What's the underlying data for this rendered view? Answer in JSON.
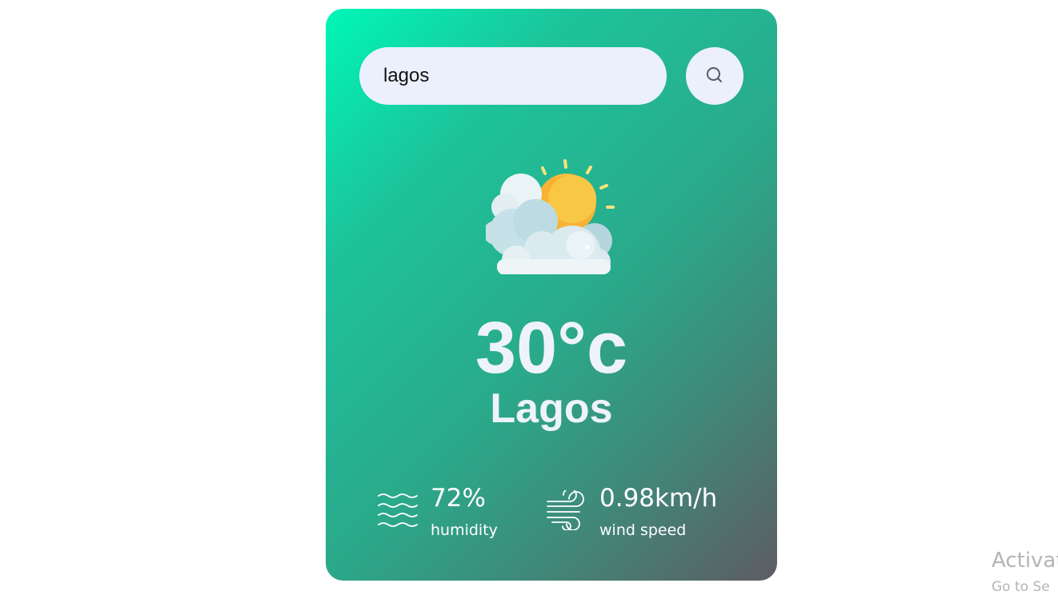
{
  "search": {
    "value": "lagos",
    "button_icon": "search-icon"
  },
  "weather": {
    "icon": "partly-cloudy-sun-icon",
    "temperature": "30°c",
    "city": "Lagos"
  },
  "details": {
    "humidity": {
      "icon": "humidity-waves-icon",
      "value": "72%",
      "label": "humidity"
    },
    "wind": {
      "icon": "wind-icon",
      "value": "0.98km/h",
      "label": "wind speed"
    }
  },
  "os_watermark": {
    "line1": "Activat",
    "line2": "Go to Se"
  },
  "colors": {
    "gradient_start": "#00f7b7",
    "gradient_end": "#5e5c63",
    "input_background": "#ecf0fd",
    "text_light": "#eef2fb"
  }
}
